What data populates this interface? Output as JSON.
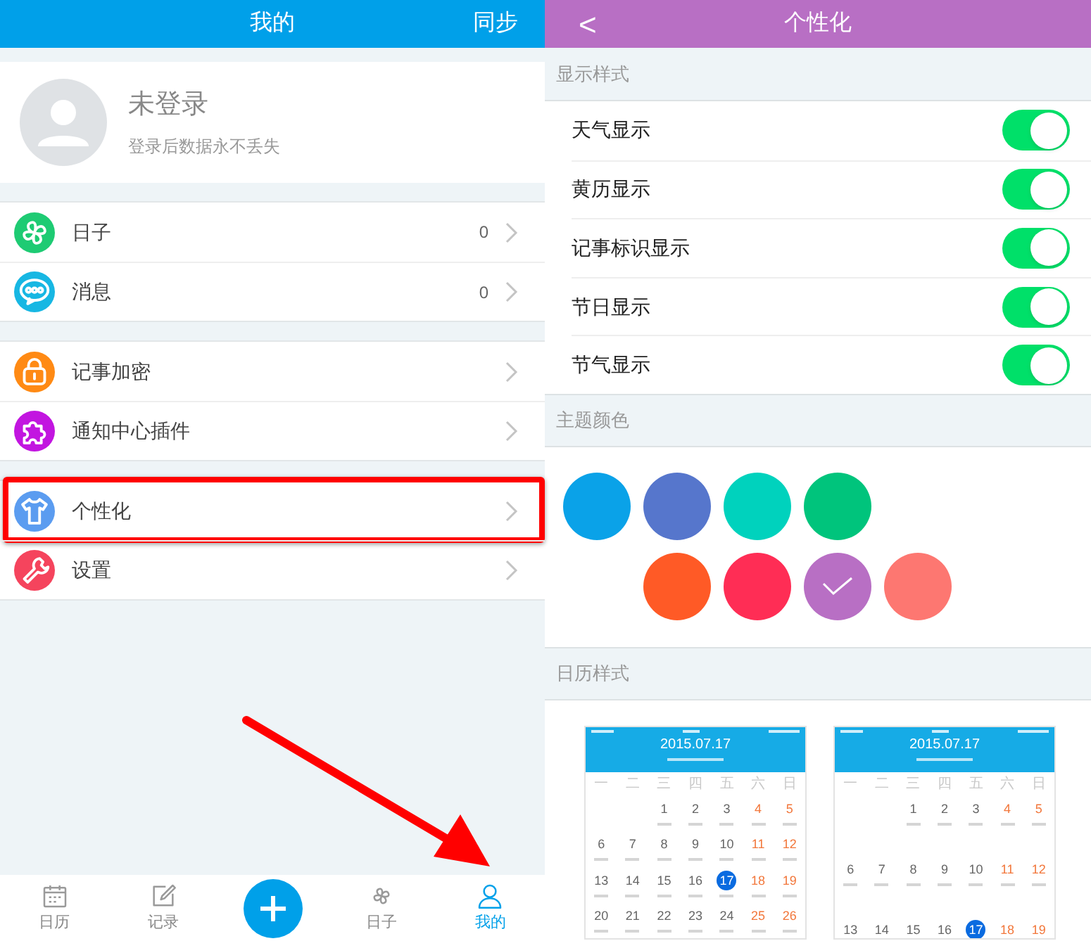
{
  "left": {
    "header": {
      "title": "我的",
      "action": "同步"
    },
    "profile": {
      "name": "未登录",
      "hint": "登录后数据永不丢失"
    },
    "groups": [
      {
        "items": [
          {
            "kind": "clover",
            "color": "#1ecb73",
            "label": "日子",
            "count": "0",
            "highlighted": false
          },
          {
            "kind": "chat",
            "color": "#17b7e3",
            "label": "消息",
            "count": "0",
            "highlighted": false
          }
        ]
      },
      {
        "items": [
          {
            "kind": "lock",
            "color": "#ff8a14",
            "label": "记事加密",
            "highlighted": false
          },
          {
            "kind": "puzzle",
            "color": "#c215e0",
            "label": "通知中心插件",
            "highlighted": false
          }
        ]
      },
      {
        "items": [
          {
            "kind": "shirt",
            "color": "#5b9cf0",
            "label": "个性化",
            "highlighted": true
          },
          {
            "kind": "wrench",
            "color": "#f5445d",
            "label": "设置",
            "highlighted": false
          }
        ]
      }
    ],
    "tabs": [
      {
        "kind": "calendar",
        "label": "日历",
        "selected": false
      },
      {
        "kind": "note",
        "label": "记录",
        "selected": false
      },
      {
        "kind": "add"
      },
      {
        "kind": "clover",
        "label": "日子",
        "selected": false
      },
      {
        "kind": "person",
        "label": "我的",
        "selected": true
      }
    ]
  },
  "right": {
    "header": {
      "back": "<",
      "title": "个性化"
    },
    "display_section": "显示样式",
    "toggles": [
      {
        "label": "天气显示",
        "on": true
      },
      {
        "label": "黄历显示",
        "on": true
      },
      {
        "label": "记事标识显示",
        "on": true
      },
      {
        "label": "节日显示",
        "on": true
      },
      {
        "label": "节气显示",
        "on": true
      }
    ],
    "color_section": "主题颜色",
    "theme_colors": [
      {
        "color": "#0aa2e8",
        "selected": false
      },
      {
        "color": "#5676cc",
        "selected": false
      },
      {
        "color": "#00d2bd",
        "selected": false
      },
      {
        "color": "#00c47c",
        "selected": false
      },
      {
        "color": "#ff5a26",
        "selected": false
      },
      {
        "color": "#ff2d55",
        "selected": false
      },
      {
        "color": "#b86fc4",
        "selected": true
      },
      {
        "color": "#fd7771",
        "selected": false
      }
    ],
    "calendar_section": "日历样式",
    "calendar_styles": [
      {
        "date": "2015.07.17",
        "kind": "compact",
        "weekdays": [
          "一",
          "二",
          "三",
          "四",
          "五",
          "六",
          "日"
        ],
        "weeks": [
          [
            {
              "kind": "empty"
            },
            {
              "kind": "empty"
            },
            {
              "day": "1",
              "weekend": false,
              "today": false
            },
            {
              "day": "2",
              "weekend": false,
              "today": false
            },
            {
              "day": "3",
              "weekend": false,
              "today": false
            },
            {
              "day": "4",
              "weekend": true,
              "today": false
            },
            {
              "day": "5",
              "weekend": true,
              "today": false
            }
          ],
          [
            {
              "day": "6",
              "weekend": false,
              "today": false
            },
            {
              "day": "7",
              "weekend": false,
              "today": false
            },
            {
              "day": "8",
              "weekend": false,
              "today": false
            },
            {
              "day": "9",
              "weekend": false,
              "today": false
            },
            {
              "day": "10",
              "weekend": false,
              "today": false
            },
            {
              "day": "11",
              "weekend": true,
              "today": false
            },
            {
              "day": "12",
              "weekend": true,
              "today": false
            }
          ],
          [
            {
              "day": "13",
              "weekend": false,
              "today": false
            },
            {
              "day": "14",
              "weekend": false,
              "today": false
            },
            {
              "day": "15",
              "weekend": false,
              "today": false
            },
            {
              "day": "16",
              "weekend": false,
              "today": false
            },
            {
              "day": "17",
              "weekend": false,
              "today": true
            },
            {
              "day": "18",
              "weekend": true,
              "today": false
            },
            {
              "day": "19",
              "weekend": true,
              "today": false
            }
          ],
          [
            {
              "day": "20",
              "weekend": false,
              "today": false
            },
            {
              "day": "21",
              "weekend": false,
              "today": false
            },
            {
              "day": "22",
              "weekend": false,
              "today": false
            },
            {
              "day": "23",
              "weekend": false,
              "today": false
            },
            {
              "day": "24",
              "weekend": false,
              "today": false
            },
            {
              "day": "25",
              "weekend": true,
              "today": false
            },
            {
              "day": "26",
              "weekend": true,
              "today": false
            }
          ]
        ]
      },
      {
        "date": "2015.07.17",
        "kind": "spacious",
        "weekdays": [
          "一",
          "二",
          "三",
          "四",
          "五",
          "六",
          "日"
        ],
        "weeks": [
          [
            {
              "kind": "empty"
            },
            {
              "kind": "empty"
            },
            {
              "day": "1",
              "weekend": false,
              "today": false
            },
            {
              "day": "2",
              "weekend": false,
              "today": false
            },
            {
              "day": "3",
              "weekend": false,
              "today": false
            },
            {
              "day": "4",
              "weekend": true,
              "today": false
            },
            {
              "day": "5",
              "weekend": true,
              "today": false
            }
          ],
          [
            {
              "day": "6",
              "weekend": false,
              "today": false
            },
            {
              "day": "7",
              "weekend": false,
              "today": false
            },
            {
              "day": "8",
              "weekend": false,
              "today": false
            },
            {
              "day": "9",
              "weekend": false,
              "today": false
            },
            {
              "day": "10",
              "weekend": false,
              "today": false
            },
            {
              "day": "11",
              "weekend": true,
              "today": false
            },
            {
              "day": "12",
              "weekend": true,
              "today": false
            }
          ],
          [
            {
              "day": "13",
              "weekend": false,
              "today": false
            },
            {
              "day": "14",
              "weekend": false,
              "today": false
            },
            {
              "day": "15",
              "weekend": false,
              "today": false
            },
            {
              "day": "16",
              "weekend": false,
              "today": false
            },
            {
              "day": "17",
              "weekend": false,
              "today": true
            },
            {
              "day": "18",
              "weekend": true,
              "today": false
            },
            {
              "day": "19",
              "weekend": true,
              "today": false
            }
          ]
        ]
      }
    ]
  }
}
